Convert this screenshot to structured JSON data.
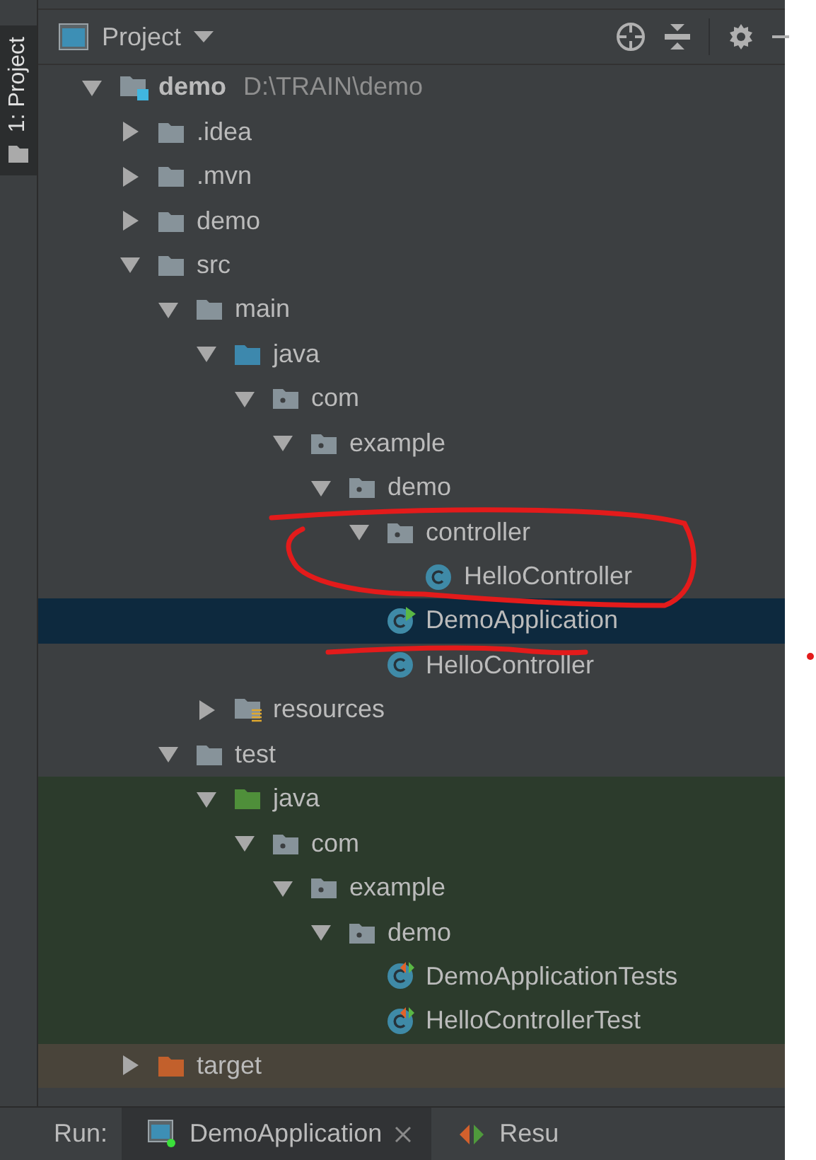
{
  "side_tabs": [
    {
      "label": "1: Project",
      "selected": true
    }
  ],
  "panel": {
    "title": "Project"
  },
  "tree": [
    {
      "name": "demo",
      "path": "D:\\TRAIN\\demo",
      "kind": "module",
      "expanded": true,
      "selected": false,
      "children": [
        {
          "name": ".idea",
          "kind": "folder",
          "expanded": false,
          "selected": false
        },
        {
          "name": ".mvn",
          "kind": "folder",
          "expanded": false,
          "selected": false
        },
        {
          "name": "demo",
          "kind": "folder",
          "expanded": false,
          "selected": false
        },
        {
          "name": "src",
          "kind": "folder",
          "expanded": true,
          "selected": false,
          "children": [
            {
              "name": "main",
              "kind": "folder",
              "expanded": true,
              "selected": false,
              "children": [
                {
                  "name": "java",
                  "kind": "source",
                  "expanded": true,
                  "selected": false,
                  "children": [
                    {
                      "name": "com",
                      "kind": "package",
                      "expanded": true,
                      "selected": false,
                      "children": [
                        {
                          "name": "example",
                          "kind": "package",
                          "expanded": true,
                          "selected": false,
                          "children": [
                            {
                              "name": "demo",
                              "kind": "package",
                              "expanded": true,
                              "selected": false,
                              "children": [
                                {
                                  "name": "controller",
                                  "kind": "package",
                                  "expanded": true,
                                  "selected": false,
                                  "children": [
                                    {
                                      "name": "HelloController",
                                      "kind": "class",
                                      "selected": false
                                    }
                                  ]
                                },
                                {
                                  "name": "DemoApplication",
                                  "kind": "app",
                                  "selected": true
                                },
                                {
                                  "name": "HelloController",
                                  "kind": "class",
                                  "selected": false
                                }
                              ]
                            }
                          ]
                        }
                      ]
                    }
                  ]
                },
                {
                  "name": "resources",
                  "kind": "resources",
                  "expanded": false,
                  "selected": false
                }
              ]
            },
            {
              "name": "test",
              "kind": "folder",
              "expanded": true,
              "selected": false,
              "children": [
                {
                  "name": "java",
                  "kind": "test_source",
                  "color": "#2c3b2c",
                  "expanded": true,
                  "selected": false,
                  "children": [
                    {
                      "name": "com",
                      "kind": "package",
                      "color": "#2c3b2c",
                      "expanded": true,
                      "selected": false,
                      "children": [
                        {
                          "name": "example",
                          "kind": "package",
                          "color": "#2c3b2c",
                          "expanded": true,
                          "selected": false,
                          "children": [
                            {
                              "name": "demo",
                              "kind": "package",
                              "color": "#2c3b2c",
                              "expanded": true,
                              "selected": false,
                              "children": [
                                {
                                  "name": "DemoApplicationTests",
                                  "kind": "test_class",
                                  "color": "#2c3b2c",
                                  "selected": false
                                },
                                {
                                  "name": "HelloControllerTest",
                                  "kind": "test_class",
                                  "color": "#2c3b2c",
                                  "selected": false
                                }
                              ]
                            }
                          ]
                        }
                      ]
                    }
                  ]
                }
              ]
            }
          ]
        },
        {
          "name": "target",
          "kind": "excluded",
          "color": "#49443a",
          "expanded": false,
          "selected": false
        }
      ]
    }
  ],
  "run_bar": {
    "label": "Run:",
    "tabs": [
      {
        "label": "DemoApplication",
        "kind": "app",
        "selected": true,
        "closable": true
      },
      {
        "label": "Resu",
        "kind": "test",
        "selected": false,
        "closable": false
      }
    ]
  },
  "annotations": [
    {
      "kind": "ellipse"
    },
    {
      "kind": "underline"
    },
    {
      "kind": "dot"
    }
  ]
}
